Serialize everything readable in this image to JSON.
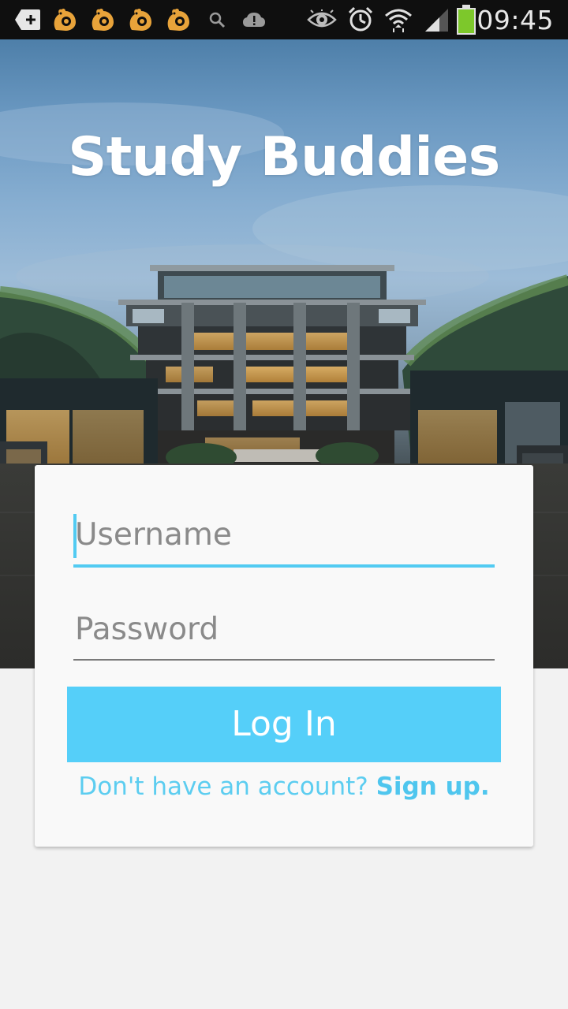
{
  "status_bar": {
    "time": "09:45",
    "left_icons": [
      "add-notification-icon",
      "squirrel-browser-icon",
      "squirrel-browser-icon",
      "squirrel-browser-icon",
      "squirrel-browser-icon",
      "search-icon",
      "cloud-alert-icon"
    ],
    "right_icons": [
      "eye-icon",
      "alarm-icon",
      "wifi-icon",
      "signal-icon",
      "battery-icon"
    ],
    "accent_colors": {
      "squirrel": "#e8a33a",
      "battery": "#7dc82b"
    }
  },
  "hero": {
    "title": "Study Buddies"
  },
  "login": {
    "username_placeholder": "Username",
    "password_placeholder": "Password",
    "login_label": "Log In",
    "signup_prompt": "Don't have an account?",
    "signup_link": "Sign up."
  },
  "colors": {
    "accent": "#55cff9",
    "field_underline_active": "#52cbf2",
    "background": "#f2f2f2"
  }
}
